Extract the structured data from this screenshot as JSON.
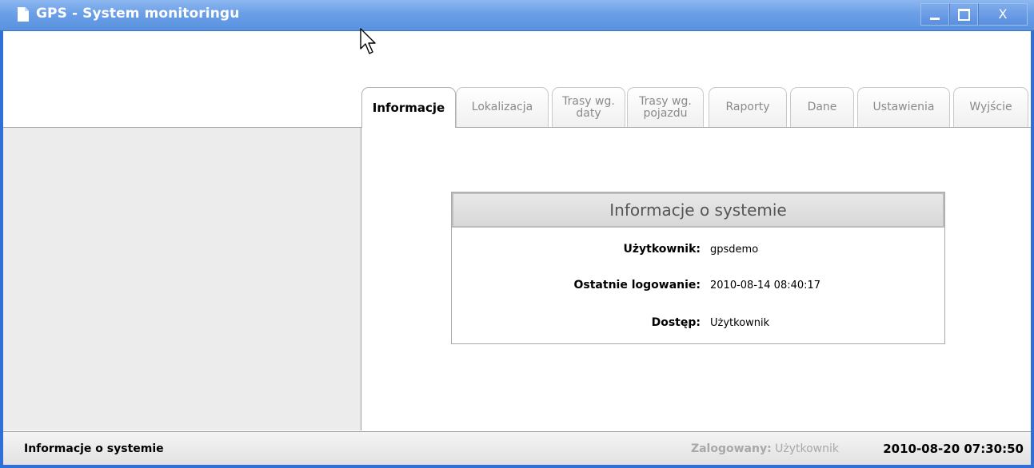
{
  "window": {
    "title": "GPS - System monitoringu",
    "close_glyph": "X"
  },
  "tabs": [
    {
      "label": "Informacje",
      "active": true
    },
    {
      "label": "Lokalizacja",
      "active": false
    },
    {
      "label": "Trasy wg.\ndaty",
      "active": false
    },
    {
      "label": "Trasy wg.\npojazdu",
      "active": false
    },
    {
      "label": "Raporty",
      "active": false
    },
    {
      "label": "Dane",
      "active": false
    },
    {
      "label": "Ustawienia",
      "active": false
    },
    {
      "label": "Wyjście",
      "active": false
    }
  ],
  "info": {
    "title": "Informacje o systemie",
    "user_label": "Użytkownik:",
    "user_value": "gpsdemo",
    "lastlogin_label": "Ostatnie logowanie:",
    "lastlogin_value": "2010-08-14 08:40:17",
    "access_label": "Dostęp:",
    "access_value": "Użytkownik"
  },
  "status": {
    "left": "Informacje o systemie",
    "logged_label": "Zalogowany:",
    "logged_value": "Użytkownik",
    "datetime": "2010-08-20 07:30:50"
  },
  "colors": {
    "titlebar": "#5a92e0",
    "sidebar": "#ececec",
    "inactive_tab_text": "#8a8a8a"
  },
  "icons": [
    "document-icon",
    "minimize-icon",
    "maximize-icon",
    "close-icon",
    "mouse-cursor-icon"
  ]
}
